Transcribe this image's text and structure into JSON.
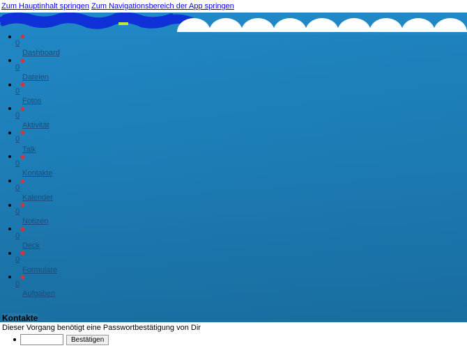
{
  "skip_links": {
    "main_content": "Zum Hauptinhalt springen",
    "app_nav": "Zum Navigationsbereich der App springen"
  },
  "nav": {
    "items": [
      {
        "count": "0",
        "label": "Dashboard"
      },
      {
        "count": "0",
        "label": "Dateien"
      },
      {
        "count": "0",
        "label": "Fotos"
      },
      {
        "count": "0",
        "label": "Aktivität"
      },
      {
        "count": "0",
        "label": "Talk"
      },
      {
        "count": "0",
        "label": "Kontakte"
      },
      {
        "count": "0",
        "label": "Kalender"
      },
      {
        "count": "0",
        "label": "Notizen"
      },
      {
        "count": "0",
        "label": "Deck"
      },
      {
        "count": "0",
        "label": "Formulare"
      },
      {
        "count": "0",
        "label": "Aufgaben"
      }
    ]
  },
  "page_title": "Kontakte",
  "confirm": {
    "message": "Dieser Vorgang benötigt eine Passwortbestätigung von Dir",
    "button": "Bestätigen",
    "placeholder": ""
  }
}
